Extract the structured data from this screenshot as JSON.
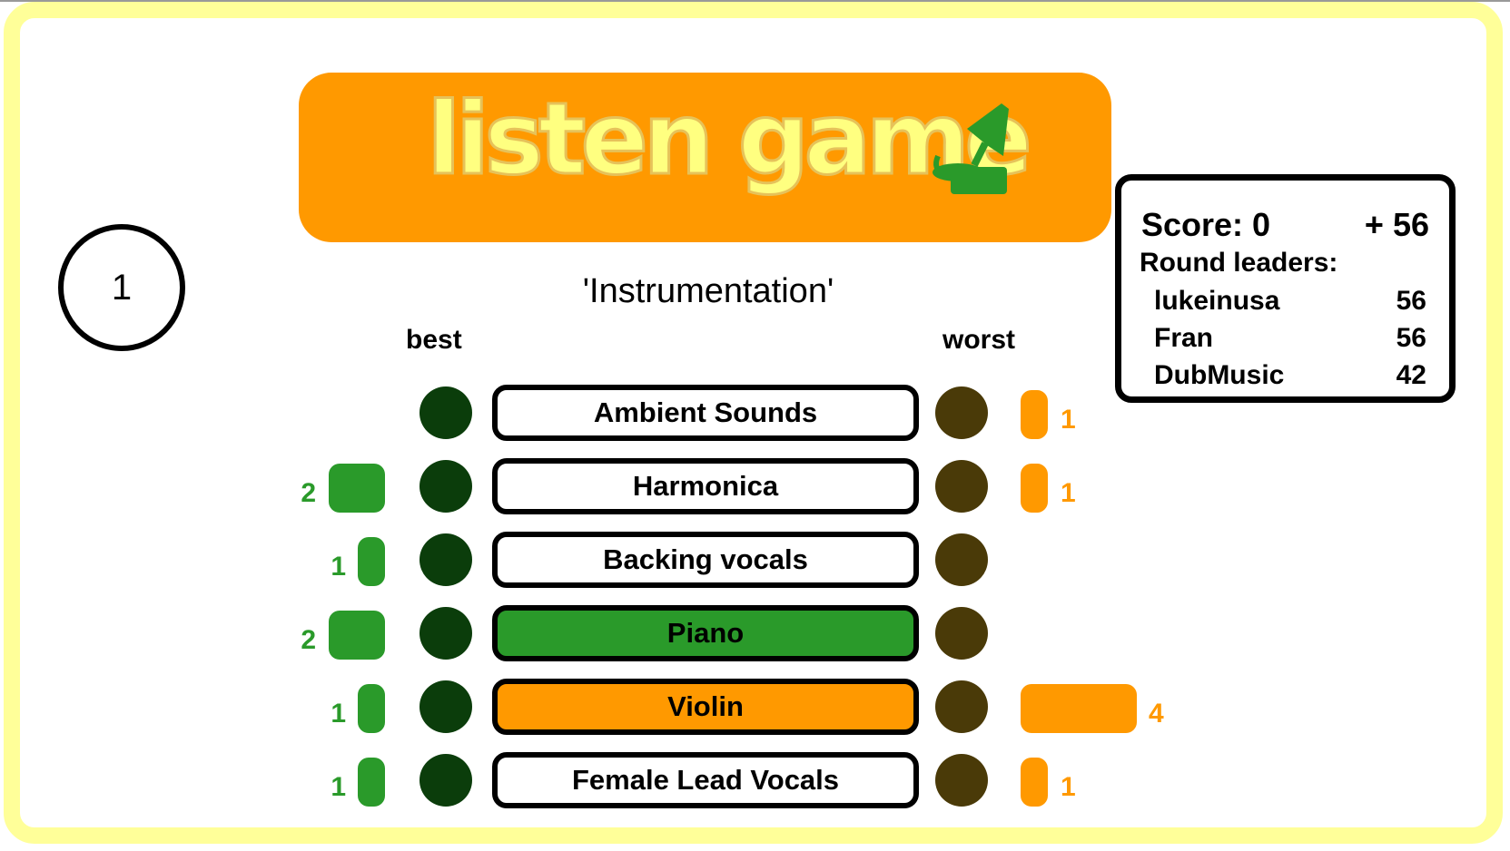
{
  "round": "1",
  "logo": {
    "text": "listen game",
    "icon": "phonograph-icon"
  },
  "category": "'Instrumentation'",
  "headers": {
    "best": "best",
    "worst": "worst"
  },
  "answers": [
    {
      "label": "Ambient Sounds",
      "best_votes": null,
      "worst_votes": 1,
      "selected": "none"
    },
    {
      "label": "Harmonica",
      "best_votes": 2,
      "worst_votes": 1,
      "selected": "none"
    },
    {
      "label": "Backing vocals",
      "best_votes": 1,
      "worst_votes": null,
      "selected": "none"
    },
    {
      "label": "Piano",
      "best_votes": 2,
      "worst_votes": null,
      "selected": "best"
    },
    {
      "label": "Violin",
      "best_votes": 1,
      "worst_votes": 4,
      "selected": "worst"
    },
    {
      "label": "Female Lead Vocals",
      "best_votes": 1,
      "worst_votes": 1,
      "selected": "none"
    }
  ],
  "labels": {
    "best_counts": [
      "",
      "2",
      "1",
      "2",
      "1",
      "1"
    ],
    "worst_counts": [
      "1",
      "1",
      "",
      "",
      "4",
      "1"
    ]
  },
  "scoreboard": {
    "score_label": "Score: 0",
    "delta": "+ 56",
    "leaders_label": "Round leaders:",
    "leaders": [
      {
        "name": "lukeinusa",
        "points": "56"
      },
      {
        "name": "Fran",
        "points": "56"
      },
      {
        "name": "DubMusic",
        "points": "42"
      }
    ]
  },
  "colors": {
    "banner": "#ff9900",
    "logo_text": "#ffff80",
    "best": "#2a9a2a",
    "worst": "#ff9900",
    "frame": "#ffff99"
  }
}
